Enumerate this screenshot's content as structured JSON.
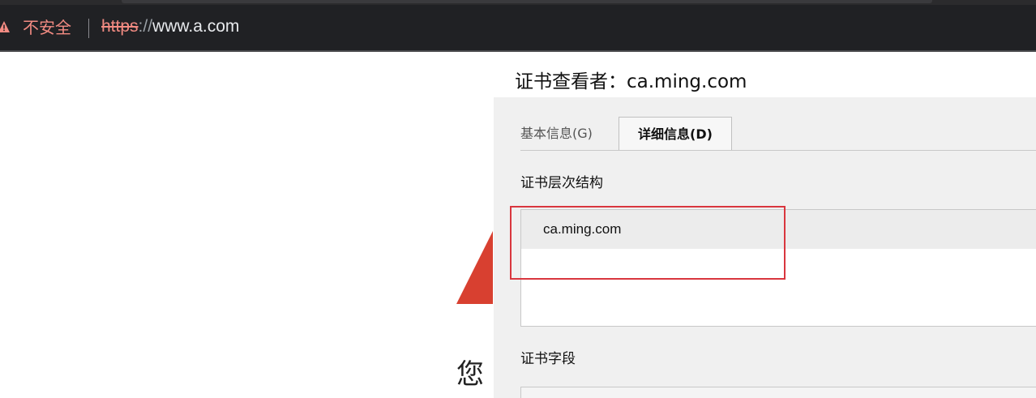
{
  "browser": {
    "security_label": "不安全",
    "url": {
      "scheme": "https",
      "slashes": "://",
      "host": "www.a.com"
    },
    "colors": {
      "warning": "#f28b82",
      "toolbar": "#202124"
    }
  },
  "background_page": {
    "partial_heading": "您",
    "icon": "warning-triangle-icon",
    "accent": "#d84030"
  },
  "dialog": {
    "title": "证书查看者：ca.ming.com",
    "tabs": [
      {
        "label": "基本信息(G)",
        "selected": false
      },
      {
        "label": "详细信息(D)",
        "selected": true
      }
    ],
    "hierarchy_label": "证书层次结构",
    "hierarchy": [
      "ca.ming.com"
    ],
    "fields_label": "证书字段"
  },
  "annotation": {
    "color": "#d9363e"
  }
}
